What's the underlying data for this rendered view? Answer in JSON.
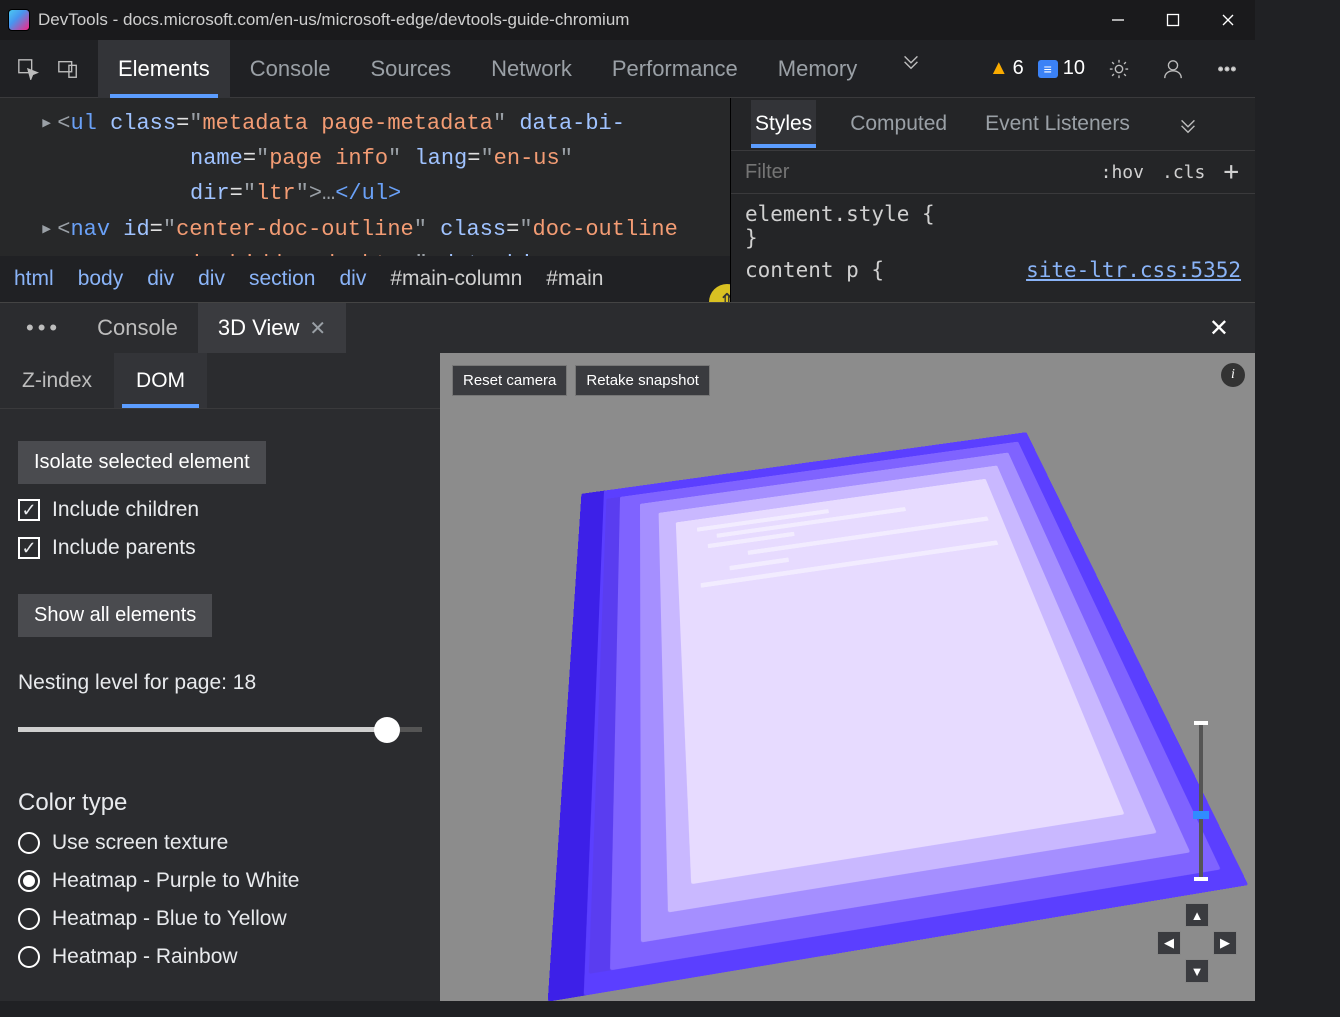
{
  "window": {
    "title": "DevTools - docs.microsoft.com/en-us/microsoft-edge/devtools-guide-chromium"
  },
  "main_tabs": {
    "items": [
      "Elements",
      "Console",
      "Sources",
      "Network",
      "Performance",
      "Memory"
    ],
    "active_index": 0
  },
  "toolbar": {
    "warn_count": "6",
    "info_count": "10"
  },
  "dom_code": {
    "line1_tag": "ul",
    "line1_attr1": "class",
    "line1_val1": "metadata page-metadata",
    "line1_attr2": "data-bi-name",
    "line1_val2": "page info",
    "line1_attr3": "lang",
    "line1_val3": "en-us",
    "line1_attr4": "dir",
    "line1_val4": "ltr",
    "line1_ellipsis": "…",
    "line1_close": "</ul>",
    "line2_tag": "nav",
    "line2_attr1": "id",
    "line2_val1": "center-doc-outline",
    "line2_attr2": "class",
    "line2_val2": "doc-outline is-hidden-desktop",
    "line2_attr3": "data-bi-name"
  },
  "breadcrumbs": [
    "html",
    "body",
    "div",
    "div",
    "section",
    "div",
    "#main-column",
    "#main"
  ],
  "styles_panel": {
    "tabs": [
      "Styles",
      "Computed",
      "Event Listeners"
    ],
    "active_index": 0,
    "filter_placeholder": "Filter",
    "hov": ":hov",
    "cls": ".cls",
    "rule0": "element.style {",
    "rule0_close": "}",
    "rule1": "content p {",
    "rule1_src": "site-ltr.css:5352"
  },
  "drawer": {
    "tab_console": "Console",
    "tab_3dview": "3D View",
    "sub_tabs": [
      "Z-index",
      "DOM"
    ],
    "sub_active_index": 1,
    "isolate_btn": "Isolate selected element",
    "include_children": "Include children",
    "include_parents": "Include parents",
    "show_all_btn": "Show all elements",
    "nesting_label": "Nesting level for page: 18",
    "color_title": "Color type",
    "radio_options": [
      "Use screen texture",
      "Heatmap - Purple to White",
      "Heatmap - Blue to Yellow",
      "Heatmap - Rainbow"
    ],
    "radio_selected_index": 1,
    "viewport": {
      "reset_btn": "Reset camera",
      "retake_btn": "Retake snapshot"
    }
  }
}
